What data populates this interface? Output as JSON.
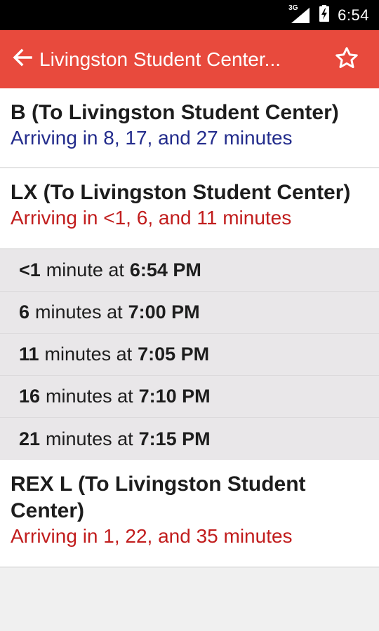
{
  "status_bar": {
    "network": "3G",
    "time": "6:54"
  },
  "app_bar": {
    "title": "Livingston Student Center..."
  },
  "routes": [
    {
      "name": "B (To Livingston Student Center)",
      "arrival": "Arriving in 8, 17, and 27 minutes",
      "arrival_color": "#232c8c"
    },
    {
      "name": "LX (To Livingston Student Center)",
      "arrival": "Arriving in <1, 6, and 11 minutes",
      "arrival_color": "#c11d1d",
      "stops": [
        {
          "minutes": "<1",
          "unit": "minute at",
          "time": "6:54 PM"
        },
        {
          "minutes": "6",
          "unit": "minutes at",
          "time": "7:00 PM"
        },
        {
          "minutes": "11",
          "unit": "minutes at",
          "time": "7:05 PM"
        },
        {
          "minutes": "16",
          "unit": "minutes at",
          "time": "7:10 PM"
        },
        {
          "minutes": "21",
          "unit": "minutes at",
          "time": "7:15 PM"
        }
      ]
    },
    {
      "name": "REX L (To Livingston Student Center)",
      "arrival": "Arriving in 1, 22, and 35 minutes",
      "arrival_color": "#c11d1d"
    }
  ],
  "icons": {
    "back": "arrow-left-icon",
    "favorite": "star-outline-icon",
    "signal": "signal-icon",
    "battery": "battery-charging-icon"
  }
}
